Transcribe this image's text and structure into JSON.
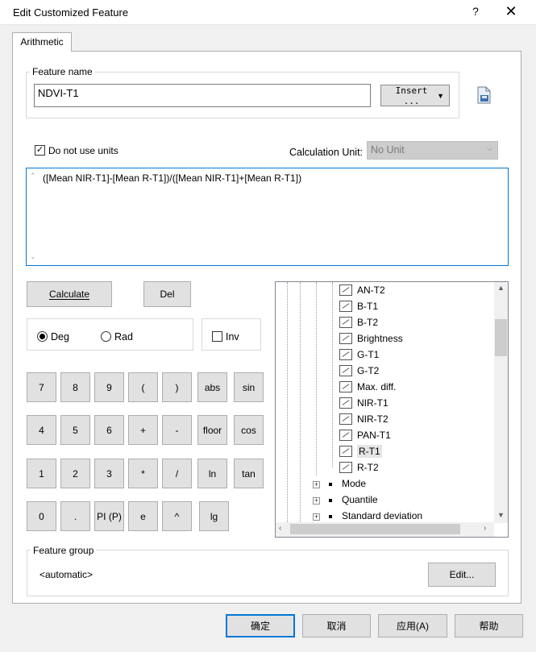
{
  "window": {
    "title": "Edit Customized Feature",
    "help": "?",
    "close": "✕"
  },
  "tab": {
    "label": "Arithmetic"
  },
  "feature_name": {
    "legend": "Feature name",
    "value": "NDVI-T1",
    "insert_label": "Insert ...",
    "insert_arrow": "▼"
  },
  "units": {
    "checkbox_label": "Do not use units",
    "checked_mark": "✓",
    "calc_unit_label": "Calculation Unit:",
    "calc_unit_value": "No Unit"
  },
  "formula": "([Mean NIR-T1]-[Mean R-T1])/([Mean NIR-T1]+[Mean R-T1])",
  "buttons": {
    "calculate": "Calculate",
    "del": "Del"
  },
  "angle": {
    "deg": "Deg",
    "rad": "Rad",
    "inv": "Inv"
  },
  "keypad": [
    [
      "7",
      "8",
      "9",
      "(",
      ")",
      "abs",
      "sin"
    ],
    [
      "4",
      "5",
      "6",
      "+",
      "-",
      "floor",
      "cos"
    ],
    [
      "1",
      "2",
      "3",
      "*",
      "/",
      "ln",
      "tan"
    ],
    [
      "0",
      ".",
      "PI (P)",
      "e",
      "^",
      "lg"
    ]
  ],
  "tree": {
    "leaves": [
      "AN-T2",
      "B-T1",
      "B-T2",
      "Brightness",
      "G-T1",
      "G-T2",
      "Max. diff.",
      "NIR-T1",
      "NIR-T2",
      "PAN-T1",
      "R-T1",
      "R-T2"
    ],
    "selected": "R-T1",
    "groups": [
      "Mode",
      "Quantile",
      "Standard deviation"
    ]
  },
  "feature_group": {
    "legend": "Feature group",
    "value": "<automatic>",
    "edit": "Edit..."
  },
  "footer": {
    "ok": "确定",
    "cancel": "取消",
    "apply": "应用(A)",
    "help": "帮助"
  }
}
